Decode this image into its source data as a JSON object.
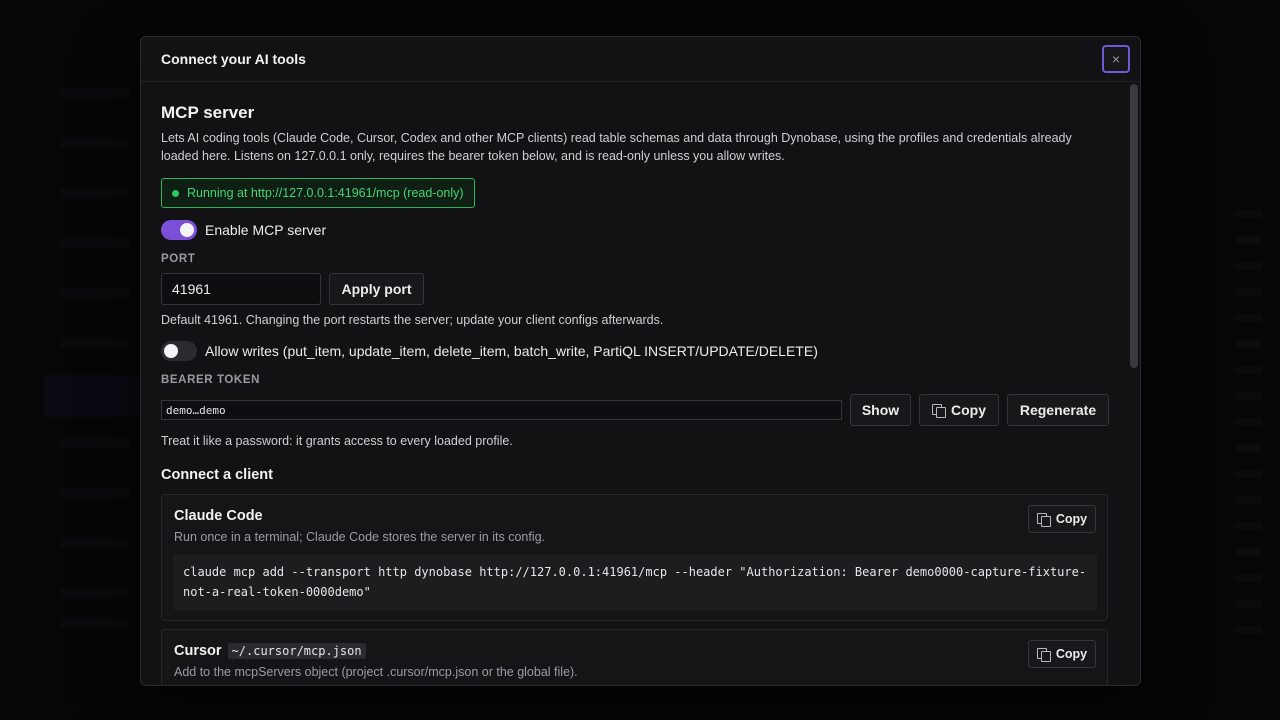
{
  "modal": {
    "title": "Connect your AI tools",
    "close_label": "×"
  },
  "mcp": {
    "section_title": "MCP server",
    "description": "Lets AI coding tools (Claude Code, Cursor, Codex and other MCP clients) read table schemas and data through Dynobase, using the profiles and credentials already loaded here. Listens on 127.0.0.1 only, requires the bearer token below, and is read-only unless you allow writes.",
    "status_text": "Running at http://127.0.0.1:41961/mcp (read-only)",
    "enable_label": "Enable MCP server",
    "enable_on": true,
    "port_label": "PORT",
    "port_value": "41961",
    "apply_port_label": "Apply port",
    "port_hint": "Default 41961. Changing the port restarts the server; update your client configs afterwards.",
    "allow_writes_label": "Allow writes (put_item, update_item, delete_item, batch_write, PartiQL INSERT/UPDATE/DELETE)",
    "allow_writes_on": false,
    "token_label": "BEARER TOKEN",
    "token_value": "demo…demo",
    "show_label": "Show",
    "copy_label": "Copy",
    "regenerate_label": "Regenerate",
    "token_hint": "Treat it like a password: it grants access to every loaded profile."
  },
  "clients": {
    "section_title": "Connect a client",
    "items": [
      {
        "title": "Claude Code",
        "path": "",
        "description": "Run once in a terminal; Claude Code stores the server in its config.",
        "copy_label": "Copy",
        "code": "claude mcp add --transport http dynobase http://127.0.0.1:41961/mcp --header \"Authorization: Bearer demo0000-capture-fixture-not-a-real-token-0000demo\""
      },
      {
        "title": "Cursor",
        "path": "~/.cursor/mcp.json",
        "description": "Add to the mcpServers object (project .cursor/mcp.json or the global file).",
        "copy_label": "Copy"
      }
    ]
  },
  "colors": {
    "accent": "#7b4fd8",
    "status_green": "#46d275",
    "focus_ring": "#6b5bd6"
  },
  "icons": {
    "copy": "copy-icon",
    "close": "close-icon",
    "status": "status-dot-icon"
  }
}
